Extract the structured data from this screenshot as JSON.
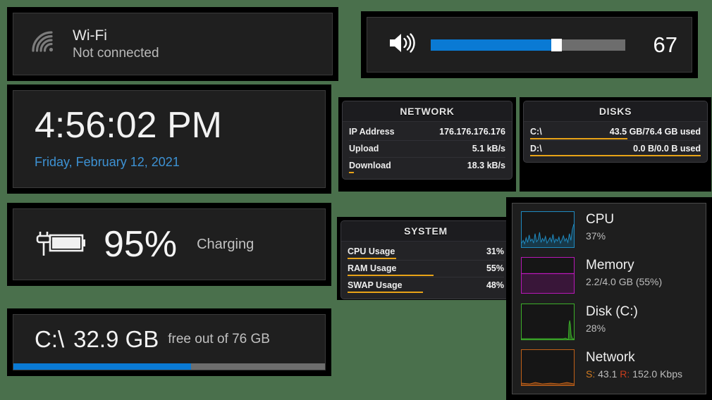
{
  "desktop": {
    "background": "#4a704c"
  },
  "wifi": {
    "icon": "wifi-icon",
    "title": "Wi-Fi",
    "status": "Not connected"
  },
  "volume": {
    "icon": "speaker-icon",
    "value": "67",
    "percent": 62
  },
  "clock": {
    "time": "4:56:02 PM",
    "date": "Friday, February 12, 2021",
    "date_color": "#3d92d4"
  },
  "battery": {
    "icon": "battery-charging-icon",
    "percent": "95%",
    "status": "Charging",
    "level": 95
  },
  "disk_free": {
    "drive": "C:\\",
    "free": "32.9 GB",
    "caption": "free out of 76 GB",
    "used_percent": 57,
    "bar_color": "#0a7ad4"
  },
  "network_gadget": {
    "title": "NETWORK",
    "rows": [
      {
        "label": "IP Address",
        "value": "176.176.176.176",
        "bar": 0
      },
      {
        "label": "Upload",
        "value": "5.1 kB/s",
        "bar": 0
      },
      {
        "label": "Download",
        "value": "18.3 kB/s",
        "bar": 3
      }
    ]
  },
  "disks_gadget": {
    "title": "DISKS",
    "rows": [
      {
        "label": "C:\\",
        "value": "43.5 GB/76.4 GB used",
        "bar": 57
      },
      {
        "label": "D:\\",
        "value": "0.0 B/0.0 B used",
        "bar": 100
      }
    ]
  },
  "system_gadget": {
    "title": "SYSTEM",
    "rows": [
      {
        "label": "CPU Usage",
        "value": "31%",
        "bar": 31
      },
      {
        "label": "RAM Usage",
        "value": "55%",
        "bar": 55
      },
      {
        "label": "SWAP Usage",
        "value": "48%",
        "bar": 48
      }
    ]
  },
  "performance": {
    "items": [
      {
        "name": "CPU",
        "detail": "37%",
        "color": "#1f8ac0",
        "graph": "sparkline"
      },
      {
        "name": "Memory",
        "detail": "2.2/4.0 GB (55%)",
        "color": "#b818b8",
        "graph": "filled-55"
      },
      {
        "name": "Disk (C:)",
        "detail": "28%",
        "color": "#3caf29",
        "graph": "spike-right"
      },
      {
        "name": "Network",
        "detail_send_label": "S:",
        "detail_send": "43.1",
        "detail_recv_label": "R:",
        "detail_recv": "152.0 Kbps",
        "color": "#c06018",
        "graph": "flat-baseline"
      }
    ]
  }
}
